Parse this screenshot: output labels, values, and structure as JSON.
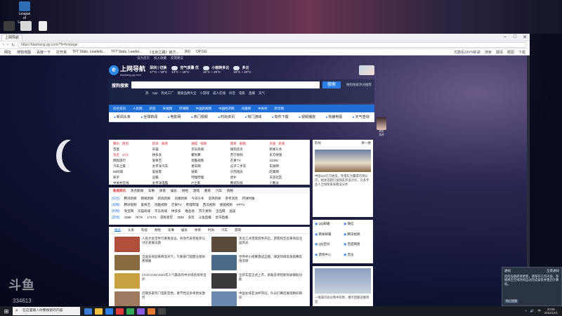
{
  "desktop": {
    "icons": [
      {
        "label": "League of Legends",
        "color": "#2f6db5"
      },
      {
        "label": "",
        "color": "#3c3c3c"
      },
      {
        "label": "",
        "color": "#d8d8d8"
      }
    ]
  },
  "browser": {
    "tab_title": "上网导航",
    "url": "https://daohang.qq.com/?fr=hmpage",
    "nav": {
      "back": "‹",
      "forward": "›",
      "refresh": "↻"
    },
    "window_controls": [
      "–",
      "□",
      "✕"
    ],
    "bookmarks": [
      "网址",
      "搜狗地图",
      "百度一下",
      "打开夹",
      "TFT Stats, Leaderb...",
      "TFT Stats, Leader...",
      "《北京之路》官方...",
      "360",
      "OP.GG"
    ],
    "bookmarks_right": [
      "优酷看ZAYN新歌",
      "搜索",
      "翻译",
      "截图",
      "下载"
    ]
  },
  "site": {
    "topline": [
      "设为首页",
      "加入收藏",
      "反馈建议"
    ],
    "logo": {
      "name": "上网导航",
      "sub": "daohang.qq.com"
    },
    "weather": [
      {
        "title": "深圳 | 切换",
        "temp": "17°C ~ 19°C"
      },
      {
        "title": "空气质量 优",
        "temp": "13°C ~ 18°C"
      },
      {
        "title": "小雨转多云",
        "temp": "16°C ~ 20°C"
      },
      {
        "title": "多云",
        "temp": "16°C ~ 24°C"
      }
    ],
    "search": {
      "engine": "搜狗搜索",
      "button": "搜索",
      "hotlink": "搜狗搜索热词推荐",
      "hotwords": [
        "热",
        "App",
        "狗式工厂",
        "搜索品牌大全",
        "小游戏",
        "成人在线",
        "抖音",
        "电影",
        "直播",
        "天气"
      ]
    },
    "category_nav": [
      "综合资讯",
      "人民网",
      "新浪",
      "央视网",
      "环球网",
      "中国新闻网",
      "中国经济网",
      "凤凰网",
      "中关村",
      "新华网"
    ],
    "quickbar": [
      "新闻头条",
      "全球新闻",
      "电影网",
      "热门视频",
      "时尚资讯",
      "热门游戏",
      "软件下载",
      "视频播放",
      "热播电视",
      "天气查询"
    ],
    "sites": [
      "腾讯 · 政府",
      "新浪 · 微博",
      "搜狐 · 视频",
      "网易 · 邮箱",
      "凤凰 · 新闻",
      "百度",
      "天猫",
      "京东商城",
      "搜狗首页",
      "新闻头条",
      "淘宝 · 21%",
      "拼多多",
      "聚划算",
      "苏宁易购",
      "东方财富",
      "携程旅行",
      "爱奇艺",
      "优酷视频",
      "芒果TV",
      "12306",
      "汽车之家",
      "太平洋汽车",
      "易车网",
      "瓜子二手车",
      "车质网",
      "58同城",
      "安居客",
      "链家",
      "贝壳找房",
      "赶集网",
      "知乎",
      "豆瓣",
      "哔哩哔哩",
      "虎扑",
      "天涯社区",
      "中关村在线",
      "太平洋电脑",
      "IT之家",
      "腾讯科技",
      "少数派"
    ],
    "news_tabs": [
      "新闻资讯",
      "热点新闻",
      "军事",
      "体育",
      "娱乐",
      "财经",
      "游戏",
      "教育",
      "汽车",
      "购物"
    ],
    "link_rows": [
      {
        "tag": "[综合]",
        "items": [
          "腾讯新闻",
          "网易新闻",
          "新浪新闻",
          "凤凰新闻",
          "今日头条",
          "澎湃新闻",
          "参考消息",
          "环球时报"
        ]
      },
      {
        "tag": "[视频]",
        "items": [
          "腾讯视频",
          "爱奇艺",
          "优酷视频",
          "芒果TV",
          "哔哩哔哩",
          "西瓜视频",
          "搜狐视频",
          "PPTV"
        ]
      },
      {
        "tag": "[购物]",
        "items": [
          "淘宝网",
          "天猫商城",
          "京东商城",
          "拼多多",
          "唯品会",
          "苏宁易购",
          "当当网",
          "国美"
        ]
      },
      {
        "tag": "[游戏]",
        "items": [
          "4399",
          "7K7K",
          "17173",
          "游民星空",
          "3DM",
          "多玩",
          "斗鱼直播",
          "虎牙直播"
        ]
      }
    ],
    "feed_tabs": [
      "精选",
      "头条",
      "科技",
      "财经",
      "军事",
      "娱乐",
      "体育",
      "时尚",
      "汽车",
      "游戏"
    ],
    "feed": [
      {
        "text": "人民大会堂举行重要会议，各地代表积极参与讨论发展议题",
        "thumb": "#b0503c"
      },
      {
        "text": "黑龙江冰雪旅游季开启，游客纷至沓来体验北国风光",
        "thumb": "#5a4a3a"
      },
      {
        "text": "全国多地迎来降温天气，气象部门提醒注意防寒保暖",
        "thumb": "#8a6a40"
      },
      {
        "text": "世界杯小组赛激战正酣，球迷热情高涨观赛氛围浓厚",
        "thumb": "#4a6a8a"
      },
      {
        "text": "CCO.COM 2022年人气最高的中文域名榜单出炉",
        "thumb": "#c8a040"
      },
      {
        "text": "全新车型正式上市，搭载多项智能驾驶辅助功能",
        "thumb": "#3a3a3a"
      },
      {
        "text": "近期多部热门电影定档，春节档竞争将更加激烈",
        "thumb": "#a07a60"
      },
      {
        "text": "中国女排亚洲杯夺冠，队员们赛后展现精彩瞬间",
        "thumb": "#6a8ab0"
      }
    ],
    "right_top": {
      "head": "影视",
      "more": "换一换",
      "text": "中国110亿元拍卖，凭借实力赢得市场认可，相关话题引发网友热议讨论，众多专业人士纷纷发表看法分析"
    },
    "right_buttons": [
      "QQ邮箱",
      "微信",
      "网易邮箱",
      "腾讯视频",
      "QQ空间",
      "百度网盘",
      "游戏中心",
      "音乐"
    ],
    "right_bottom": {
      "text": "一线城市房价稳中有降，楼市回暖迹象明显"
    },
    "side_ad": [
      "精彩",
      "推荐"
    ]
  },
  "notification": {
    "title": "通知",
    "sub": "全景通知",
    "body": "您的设备即将更新，请保存工作内容，系统将在空闲时间自动完成安装并重启计算机。",
    "button": "稍后提醒"
  },
  "taskbar": {
    "start": "⊞",
    "search_placeholder": "在这里输入你要搜索的内容",
    "apps": [
      "#3a7bd5",
      "#f0c040",
      "#2d7de6",
      "#e4393c",
      "#33a853",
      "#8a5ae0",
      "#e07a30",
      "#444444"
    ],
    "tray": [
      "^",
      "🔊",
      "中"
    ],
    "time": "20:06",
    "date": "2022/12/1"
  },
  "watermark": {
    "text": "斗鱼",
    "num": "334613"
  }
}
